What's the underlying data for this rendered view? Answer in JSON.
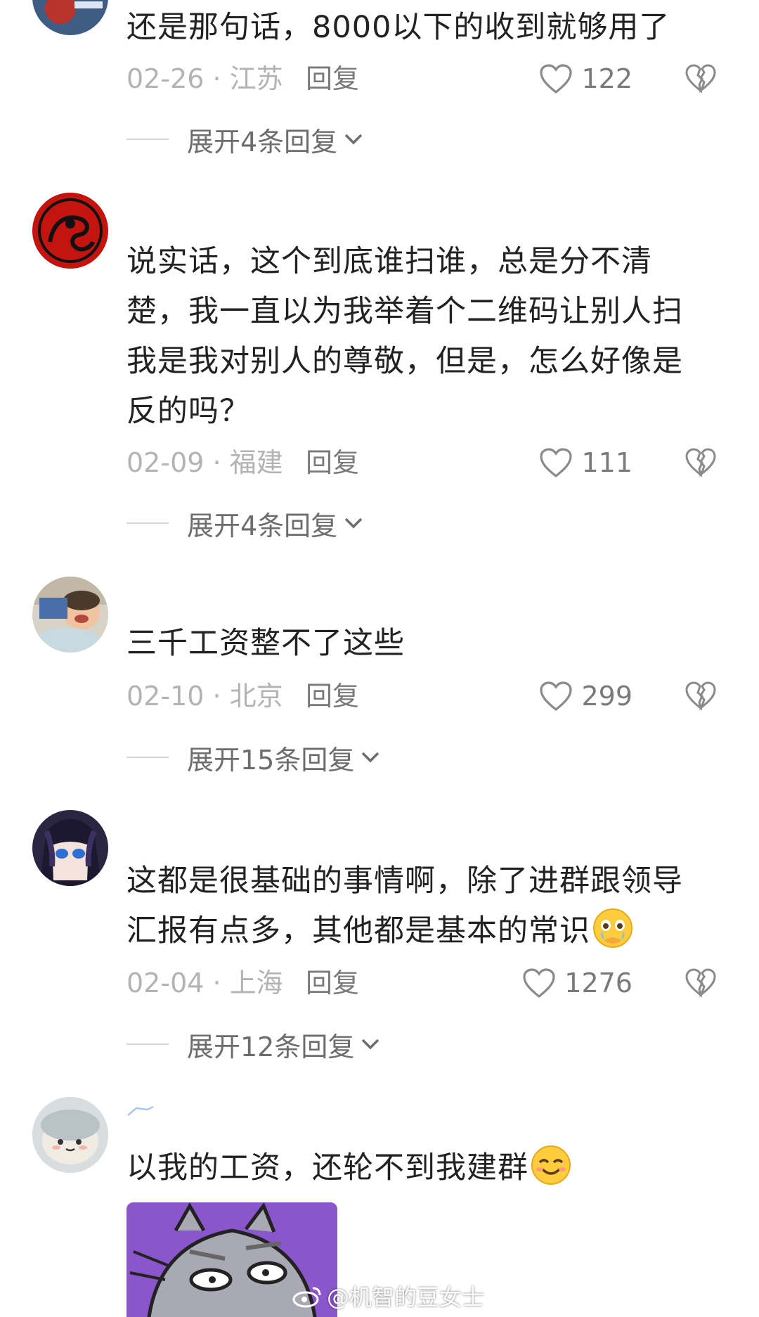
{
  "comments": [
    {
      "text": "还是那句话，8000以下的收到就够用了",
      "date": "02-26 · 江苏",
      "reply": "回复",
      "likes": "122",
      "expand": "展开4条回复"
    },
    {
      "text": "说实话，这个到底谁扫谁，总是分不清楚，我一直以为我举着个二维码让别人扫我是我对别人的尊敬，但是，怎么好像是反的吗？",
      "date": "02-09 · 福建",
      "reply": "回复",
      "likes": "111",
      "expand": "展开4条回复"
    },
    {
      "text": "三千工资整不了这些",
      "date": "02-10 · 北京",
      "reply": "回复",
      "likes": "299",
      "expand": "展开15条回复"
    },
    {
      "text": "这都是很基础的事情啊，除了进群跟领导汇报有点多，其他都是基本的常识",
      "date": "02-04 · 上海",
      "reply": "回复",
      "likes": "1276",
      "expand": "展开12条回复"
    },
    {
      "text": "以我的工资，还轮不到我建群"
    }
  ],
  "watermark": "@机智的豆女士",
  "colors": {
    "text": "#222222",
    "meta": "#b3b3b3",
    "action": "#7a7a7a"
  }
}
